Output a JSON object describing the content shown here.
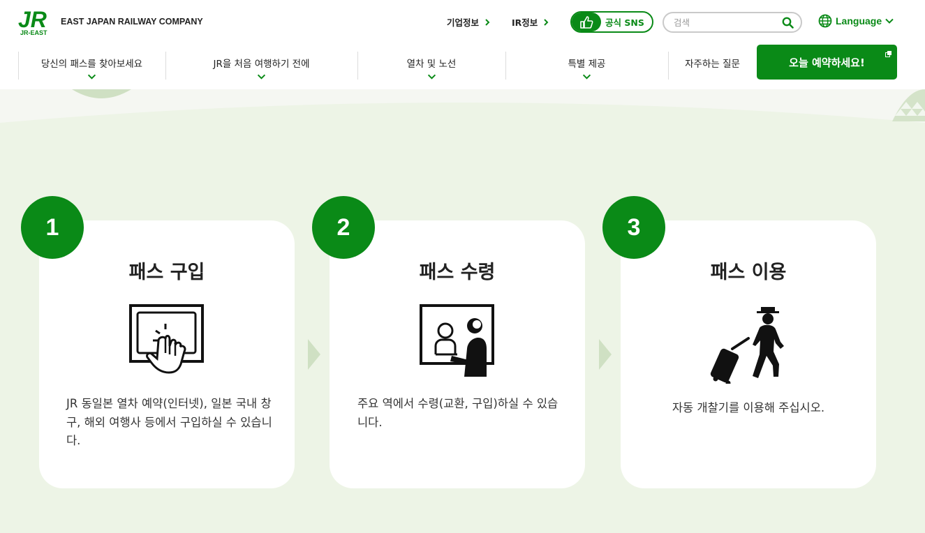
{
  "header": {
    "logo_text": "JR",
    "logo_sub": "JR-EAST",
    "company": "EAST JAPAN RAILWAY COMPANY",
    "links": [
      {
        "label": "기업정보"
      },
      {
        "label": "IR정보"
      }
    ],
    "sns_label": "공식 SNS",
    "search_placeholder": "검색",
    "language_label": "Language"
  },
  "nav": {
    "items": [
      {
        "label": "당신의 패스를 찾아보세요"
      },
      {
        "label": "JR을 처음 여행하기 전에"
      },
      {
        "label": "열차 및 노선"
      },
      {
        "label": "특별 제공"
      },
      {
        "label": "자주하는 질문"
      }
    ],
    "cta_label": "오늘 예약하세요!"
  },
  "steps": [
    {
      "number": "1",
      "title": "패스 구입",
      "icon": "touchscreen-icon",
      "text": "JR 동일본 열차 예약(인터넷), 일본 국내 창구, 해외 여행사 등에서 구입하실 수 있습니다."
    },
    {
      "number": "2",
      "title": "패스 수령",
      "icon": "ticket-counter-icon",
      "text": "주요 역에서 수령(교환, 구입)하실 수 있습니다."
    },
    {
      "number": "3",
      "title": "패스 이용",
      "icon": "traveler-icon",
      "text": "자동 개찰기를 이용해 주십시오."
    }
  ],
  "colors": {
    "brand_green": "#0a8a17",
    "background": "#edf4e6",
    "card": "#ffffff"
  }
}
